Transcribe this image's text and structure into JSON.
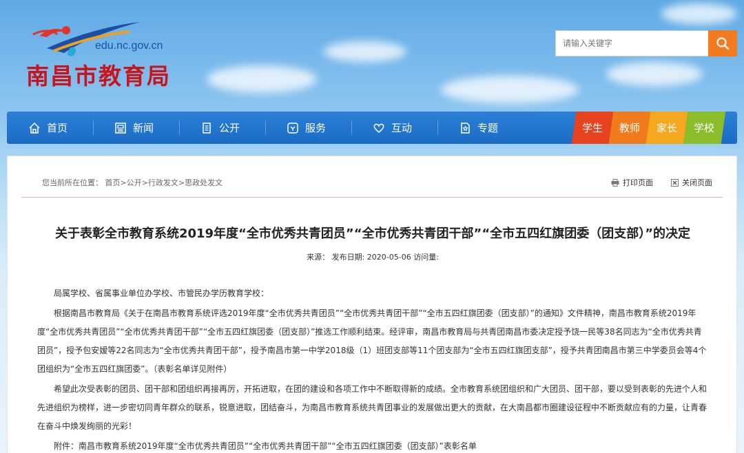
{
  "header": {
    "domain": "edu.nc.gov.cn",
    "site_title": "南昌市教育局",
    "search_placeholder": "请输入关键字"
  },
  "nav": {
    "items": [
      {
        "label": "首页",
        "icon": "home-icon"
      },
      {
        "label": "新闻",
        "icon": "newspaper-icon"
      },
      {
        "label": "公开",
        "icon": "document-icon"
      },
      {
        "label": "服务",
        "icon": "service-icon"
      },
      {
        "label": "互动",
        "icon": "heart-icon"
      },
      {
        "label": "专题",
        "icon": "star-doc-icon"
      }
    ],
    "roles": [
      {
        "label": "学生",
        "color": "#e8431f"
      },
      {
        "label": "教师",
        "color": "#f07a1c"
      },
      {
        "label": "家长",
        "color": "#f5a71e"
      },
      {
        "label": "学校",
        "color": "#8bbd2b"
      }
    ]
  },
  "breadcrumb": {
    "text": "您当前所在位置： 首页>公开>行政发文>思政处发文"
  },
  "actions": {
    "print": "打印页面",
    "close": "关闭页面"
  },
  "article": {
    "title": "关于表彰全市教育系统2019年度“全市优秀共青团员”“全市优秀共青团干部”“全市五四红旗团委（团支部）”的决定",
    "meta": "来源：   发布日期:   2020-05-06   访问量:",
    "paragraphs": [
      "局属学校、省属事业单位办学校、市管民办学历教育学校：",
      "根据南昌市教育局《关于在南昌市教育系统评选2019年度“全市优秀共青团员”“全市优秀共青团干部”“全市五四红旗团委（团支部）”的通知》文件精神，南昌市教育系统2019年度“全市优秀共青团员”“全市优秀共青团干部”“全市五四红旗团委（团支部）”推选工作顺利结束。经评审，南昌市教育局与共青团南昌市委决定授予饶一民等38名同志为“全市优秀共青团员”，授予包安嫒等22名同志为“全市优秀共青团干部”，授予南昌市第一中学2018级（1）班团支部等11个团支部为“全市五四红旗团支部”，授予共青团南昌市第三中学委员会等4个团组织为“全市五四红旗团委”。（表彰名单详见附件）",
      "希望此次受表彰的团员、团干部和团组织再接再厉，开拓进取，在团的建设和各项工作中不断取得新的成绩。全市教育系统团组织和广大团员、团干部，要以受到表彰的先进个人和先进组织为榜样，进一步密切同青年群众的联系，锐意进取，团结奋斗，为南昌市教育系统共青团事业的发展做出更大的贡献，在大南昌都市圈建设征程中不断贡献应有的力量，让青春在奋斗中焕发绚丽的光彩！",
      "附件：南昌市教育系统2019年度“全市优秀共青团员”“全市优秀共青团干部”“全市五四红旗团委（团支部）”表彰名单"
    ]
  }
}
